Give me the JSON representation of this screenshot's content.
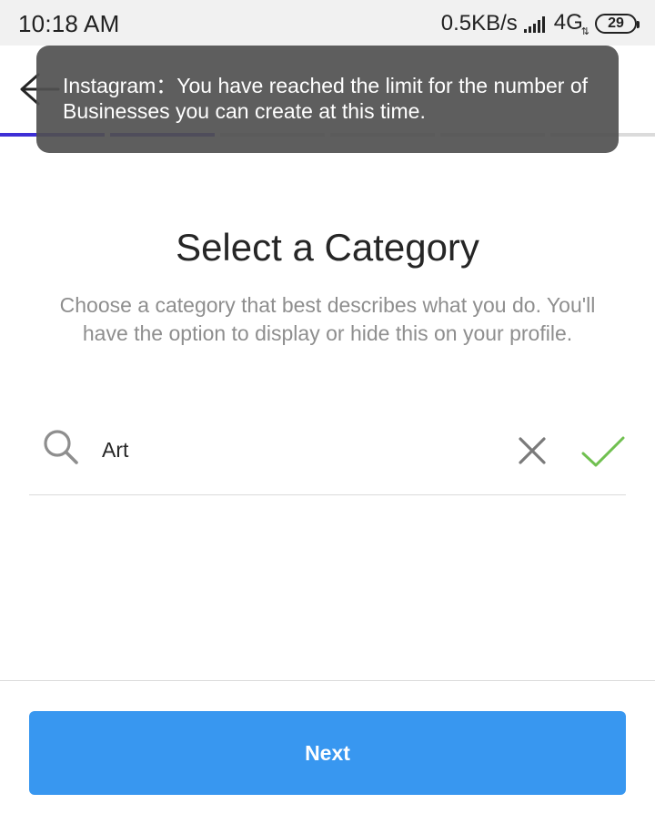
{
  "status_bar": {
    "time": "10:18 AM",
    "network_speed": "0.5KB/s",
    "network_type": "4G",
    "network_arrows": "⇅",
    "battery": "29"
  },
  "toast": {
    "message": "Instagram：You have reached the limit for the number of Businesses you can create at this time."
  },
  "progress": {
    "segments": 6,
    "active_segments": 2
  },
  "page": {
    "title": "Select a Category",
    "subtitle": "Choose a category that best describes what you do. You'll have the option to display or hide this on your profile."
  },
  "search": {
    "value": "Art",
    "placeholder": ""
  },
  "footer": {
    "next_label": "Next"
  },
  "colors": {
    "accent_blue": "#3897f0",
    "check_green": "#70c050",
    "progress_active": "#3e2fd6",
    "toast_bg": "#505050"
  },
  "icons": {
    "back": "back-arrow-icon",
    "search": "search-icon",
    "clear": "close-icon",
    "confirm": "checkmark-icon",
    "signal": "signal-bars-icon",
    "battery": "battery-icon"
  }
}
